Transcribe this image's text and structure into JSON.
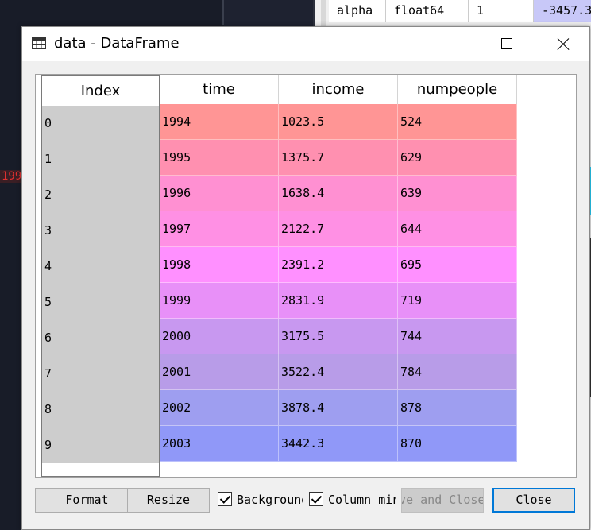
{
  "background": {
    "red_text": "199",
    "var_row": [
      "alpha",
      "float64",
      "1",
      "-3457.3"
    ]
  },
  "window": {
    "title": "data - DataFrame",
    "icon": "table-grid-icon"
  },
  "table": {
    "index_header": "Index",
    "columns": [
      "time",
      "income",
      "numpeople"
    ],
    "rows": [
      {
        "index": "0",
        "cells": [
          "1994",
          "1023.5",
          "524"
        ]
      },
      {
        "index": "1",
        "cells": [
          "1995",
          "1375.7",
          "629"
        ]
      },
      {
        "index": "2",
        "cells": [
          "1996",
          "1638.4",
          "639"
        ]
      },
      {
        "index": "3",
        "cells": [
          "1997",
          "2122.7",
          "644"
        ]
      },
      {
        "index": "4",
        "cells": [
          "1998",
          "2391.2",
          "695"
        ]
      },
      {
        "index": "5",
        "cells": [
          "1999",
          "2831.9",
          "719"
        ]
      },
      {
        "index": "6",
        "cells": [
          "2000",
          "3175.5",
          "744"
        ]
      },
      {
        "index": "7",
        "cells": [
          "2001",
          "3522.4",
          "784"
        ]
      },
      {
        "index": "8",
        "cells": [
          "2002",
          "3878.4",
          "878"
        ]
      },
      {
        "index": "9",
        "cells": [
          "2003",
          "3442.3",
          "870"
        ]
      }
    ],
    "row_colors": [
      "#ff9595",
      "#ff90b0",
      "#ff90d2",
      "#ff90e4",
      "#ff90ff",
      "#e890f8",
      "#c898f0",
      "#b89ce8",
      "#9e9ef0",
      "#9098f8"
    ]
  },
  "footer": {
    "format_label": "Format",
    "resize_label": "Resize",
    "background_label": "Background color",
    "column_label": "Column min/max",
    "save_close_label": "Save and Close",
    "close_label": "Close"
  }
}
